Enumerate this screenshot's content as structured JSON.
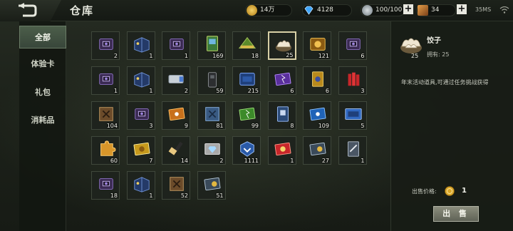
{
  "header": {
    "title": "仓库",
    "coins": "14万",
    "diamonds": "4128",
    "stamina": "100/100",
    "tickets": "34",
    "net_status": "35MS"
  },
  "sidebar": {
    "tabs": [
      {
        "label": "全部",
        "active": true
      },
      {
        "label": "体验卡",
        "active": false
      },
      {
        "label": "礼包",
        "active": false
      },
      {
        "label": "消耗品",
        "active": false
      }
    ]
  },
  "items": [
    {
      "icon": "purple-chest-icon",
      "count": "2"
    },
    {
      "icon": "blue-box-icon",
      "count": "1"
    },
    {
      "icon": "purple-chest-icon",
      "count": "1"
    },
    {
      "icon": "card-pack-icon",
      "count": "169"
    },
    {
      "icon": "zongzi-icon",
      "count": "18"
    },
    {
      "icon": "dumpling-icon",
      "count": "25",
      "selected": true
    },
    {
      "icon": "gold-crate-icon",
      "count": "121"
    },
    {
      "icon": "purple-chest-icon",
      "count": "6"
    },
    {
      "icon": "purple-chest-icon",
      "count": "1"
    },
    {
      "icon": "blue-box-icon",
      "count": "1"
    },
    {
      "icon": "ammo-clip-icon",
      "count": "2"
    },
    {
      "icon": "radio-icon",
      "count": "59"
    },
    {
      "icon": "blue-crate-icon",
      "count": "215"
    },
    {
      "icon": "purple-ticket-icon",
      "count": "6"
    },
    {
      "icon": "gold-card-icon",
      "count": "6"
    },
    {
      "icon": "firecracker-icon",
      "count": "3"
    },
    {
      "icon": "brown-book-icon",
      "count": "104"
    },
    {
      "icon": "purple-chest-icon",
      "count": "3"
    },
    {
      "icon": "orange-ticket-icon",
      "count": "9"
    },
    {
      "icon": "blue-book-icon",
      "count": "81"
    },
    {
      "icon": "green-ticket-icon",
      "count": "99"
    },
    {
      "icon": "blue-card-icon",
      "count": "8"
    },
    {
      "icon": "blue-ticket-icon",
      "count": "109"
    },
    {
      "icon": "rename-card-icon",
      "count": "5"
    },
    {
      "icon": "puzzle-icon",
      "count": "60"
    },
    {
      "icon": "gold-ticket-icon",
      "count": "7"
    },
    {
      "icon": "brush-icon",
      "count": "14"
    },
    {
      "icon": "diamond-card-icon",
      "count": "2"
    },
    {
      "icon": "rank-badge-icon",
      "count": "1111"
    },
    {
      "icon": "red-card-icon",
      "count": "1"
    },
    {
      "icon": "monthly-card-icon",
      "count": "27"
    },
    {
      "icon": "rifle-card-icon",
      "count": "1"
    },
    {
      "icon": "purple-chest-icon",
      "count": "18"
    },
    {
      "icon": "blue-box-icon",
      "count": "1"
    },
    {
      "icon": "brown-book-icon",
      "count": "52"
    },
    {
      "icon": "monthly-card-icon",
      "count": "51"
    }
  ],
  "detail": {
    "name": "饺子",
    "count": "25",
    "owned": "拥有: 25",
    "description": "年末活动道具,可通过任务挑战获得",
    "price_label": "出售价格:",
    "price": "1",
    "sell_label": "出 售"
  },
  "colors": {
    "accent": "#d8d0a6",
    "coin": "#d9a62a",
    "diamond": "#3fa6ff"
  }
}
